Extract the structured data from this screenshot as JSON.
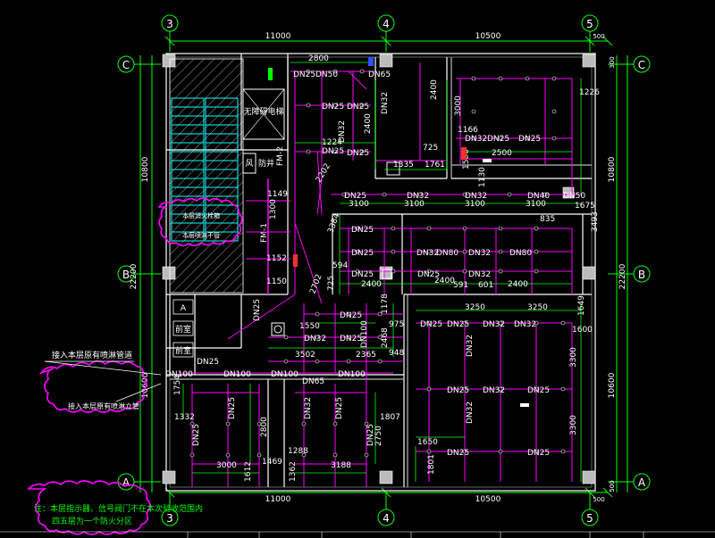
{
  "axes": {
    "top": [
      "3",
      "4",
      "5"
    ],
    "bottom": [
      "3",
      "4",
      "5"
    ],
    "left": [
      "C",
      "B",
      "A"
    ],
    "right": [
      "C",
      "B",
      "A"
    ]
  },
  "dimensions": {
    "top_spans": [
      "11000",
      "10500",
      "500"
    ],
    "bottom_spans": [
      "11000",
      "10500",
      "500"
    ],
    "left_total": "22200",
    "left_upper": "10800",
    "left_lower": "10600",
    "right_total": "22200",
    "right_upper": "10800",
    "right_lower": "10600",
    "right_top": "300",
    "right_bottom": "500"
  },
  "pipe_labels": [
    "DN25",
    "DN50",
    "DN65",
    "DN25",
    "DN32",
    "DN25",
    "DN25",
    "DN32",
    "DN25",
    "DN32",
    "DN25",
    "DN25",
    "DN25",
    "DN32",
    "DN32",
    "DN40",
    "DN50",
    "DN25",
    "DN25",
    "DN25",
    "DN32",
    "DN80",
    "DN32",
    "DN80",
    "DN25",
    "DN25",
    "DN32",
    "DN32",
    "DN25",
    "DN25",
    "DN25",
    "DN32",
    "DN32",
    "DN32",
    "DN25",
    "DN25",
    "DN100",
    "DN100",
    "DN100",
    "DN100",
    "DN100",
    "DN65",
    "DN25",
    "DN25",
    "DN32",
    "DN25",
    "DN25",
    "DN25",
    "DN32",
    "DN25",
    "DN25",
    "DN32",
    "DN25"
  ],
  "dim_labels": [
    "2800",
    "2400",
    "3000",
    "2400",
    "1224",
    "1166",
    "2500",
    "1226",
    "1335",
    "1761",
    "725",
    "3100",
    "3100",
    "3100",
    "3100",
    "1675",
    "2400",
    "2400",
    "591",
    "601",
    "2400",
    "1150",
    "1152",
    "1550",
    "3250",
    "3250",
    "1649",
    "1600",
    "3300",
    "3300",
    "3502",
    "2365",
    "948",
    "1754",
    "1332",
    "2800",
    "3000",
    "1469",
    "1288",
    "1612",
    "1362",
    "3188",
    "1807",
    "2750",
    "1650",
    "1801",
    "1130",
    "2202",
    "3384",
    "2702",
    "594",
    "725",
    "835",
    "3493",
    "1506",
    "1149",
    "1300",
    "1178",
    "975",
    "2468"
  ],
  "room_labels": {
    "stair_block": "无障碍电梯",
    "fan_room": "风",
    "shaft": "防井",
    "fm_label": "FM-2",
    "fm_label2": "FM-1",
    "room_a": "A",
    "room_b": "前室",
    "room_c": "前室"
  },
  "clouds": {
    "cloud1_line1": "本层消火栓箱",
    "cloud1_line2": "本层喷淋干管",
    "cloud2_text": "接入本层原有喷淋立管"
  },
  "notes": {
    "left_note": "接入本层原有喷淋管道",
    "bottom_note_line1": "注：本层指示器、信号阀门不在本次验收范围内",
    "bottom_note_line2": "四五层为一个防火分区"
  },
  "colors": {
    "pipe": "#ff00ff",
    "wall": "#ffffff",
    "dim": "#00ff00",
    "grid": "#00ff00",
    "hatch": "#ffffff",
    "stair": "#00ffff",
    "cloud": "#ff00ff"
  }
}
